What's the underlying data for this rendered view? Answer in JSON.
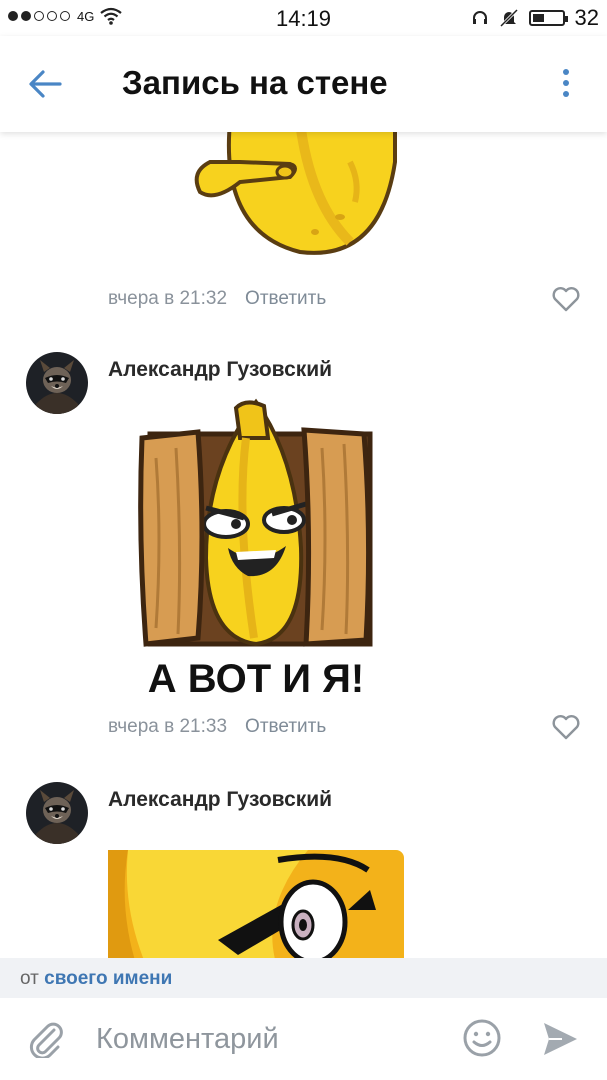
{
  "status_bar": {
    "network": "4G",
    "time": "14:19",
    "battery": "32"
  },
  "header": {
    "title": "Запись на стене",
    "back_icon": "arrow-left-icon",
    "menu_icon": "more-vertical-icon"
  },
  "accent": "#4a86c5",
  "comments": [
    {
      "time": "вчера в 21:32",
      "reply": "Ответить"
    },
    {
      "author": "Александр Гузовский",
      "sticker_text": "А ВОТ И Я!",
      "time": "вчера в 21:33",
      "reply": "Ответить"
    },
    {
      "author": "Александр Гузовский"
    }
  ],
  "reply_bar": {
    "prefix": "от",
    "link": "своего имени"
  },
  "composer": {
    "placeholder": "Комментарий",
    "attach_icon": "paperclip-icon",
    "emoji_icon": "smile-icon",
    "send_icon": "send-icon"
  }
}
